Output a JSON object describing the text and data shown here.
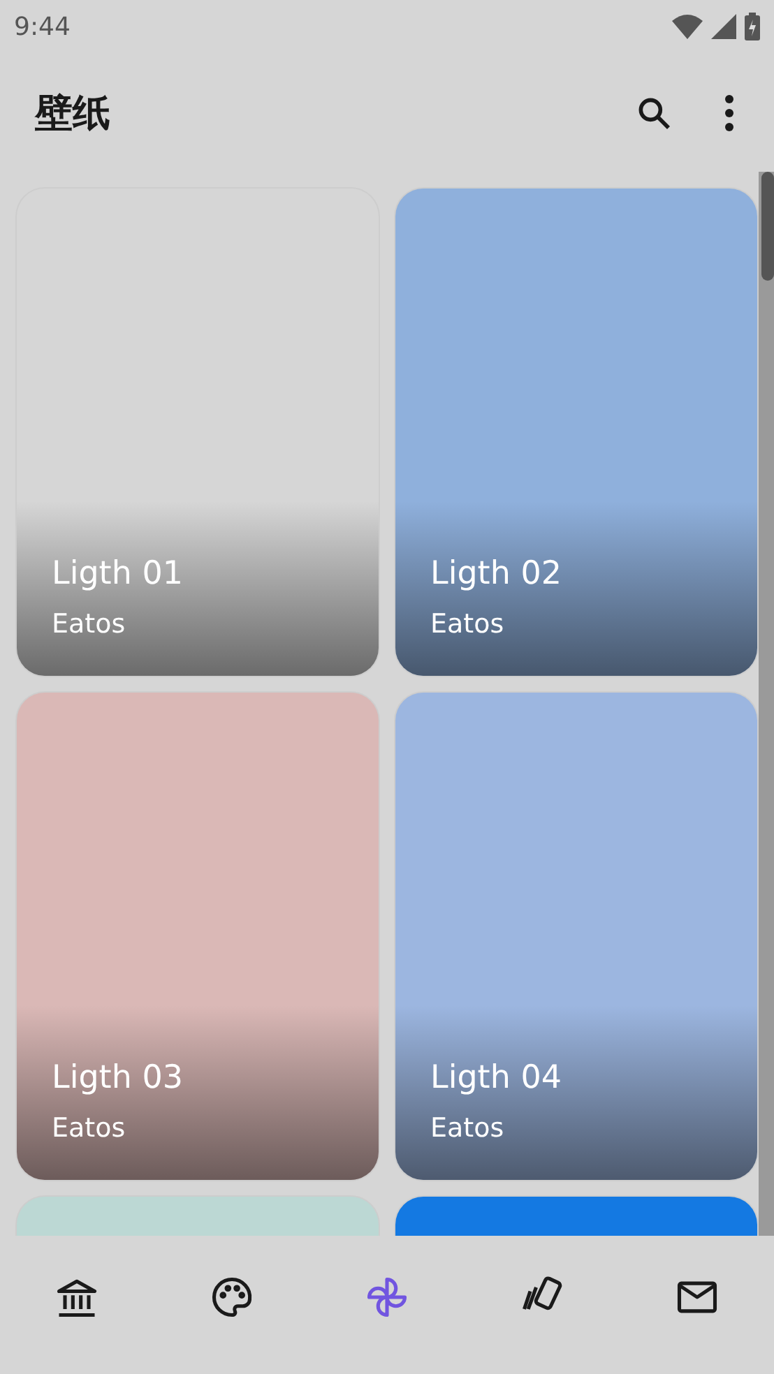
{
  "status_bar": {
    "time": "9:44"
  },
  "app_bar": {
    "title": "壁纸"
  },
  "wallpapers": [
    {
      "title": "Ligth 01",
      "author": "Eatos",
      "color": "#d6d6d6"
    },
    {
      "title": "Ligth 02",
      "author": "Eatos",
      "color": "#8fb0dc"
    },
    {
      "title": "Ligth 03",
      "author": "Eatos",
      "color": "#dab8b6"
    },
    {
      "title": "Ligth 04",
      "author": "Eatos",
      "color": "#9cb6e0"
    },
    {
      "color": "#bcd8d4"
    },
    {
      "color": "#1479e2"
    }
  ],
  "nav": [
    {
      "selected": false
    },
    {
      "selected": false
    },
    {
      "selected": true
    },
    {
      "selected": false
    },
    {
      "selected": false
    }
  ]
}
